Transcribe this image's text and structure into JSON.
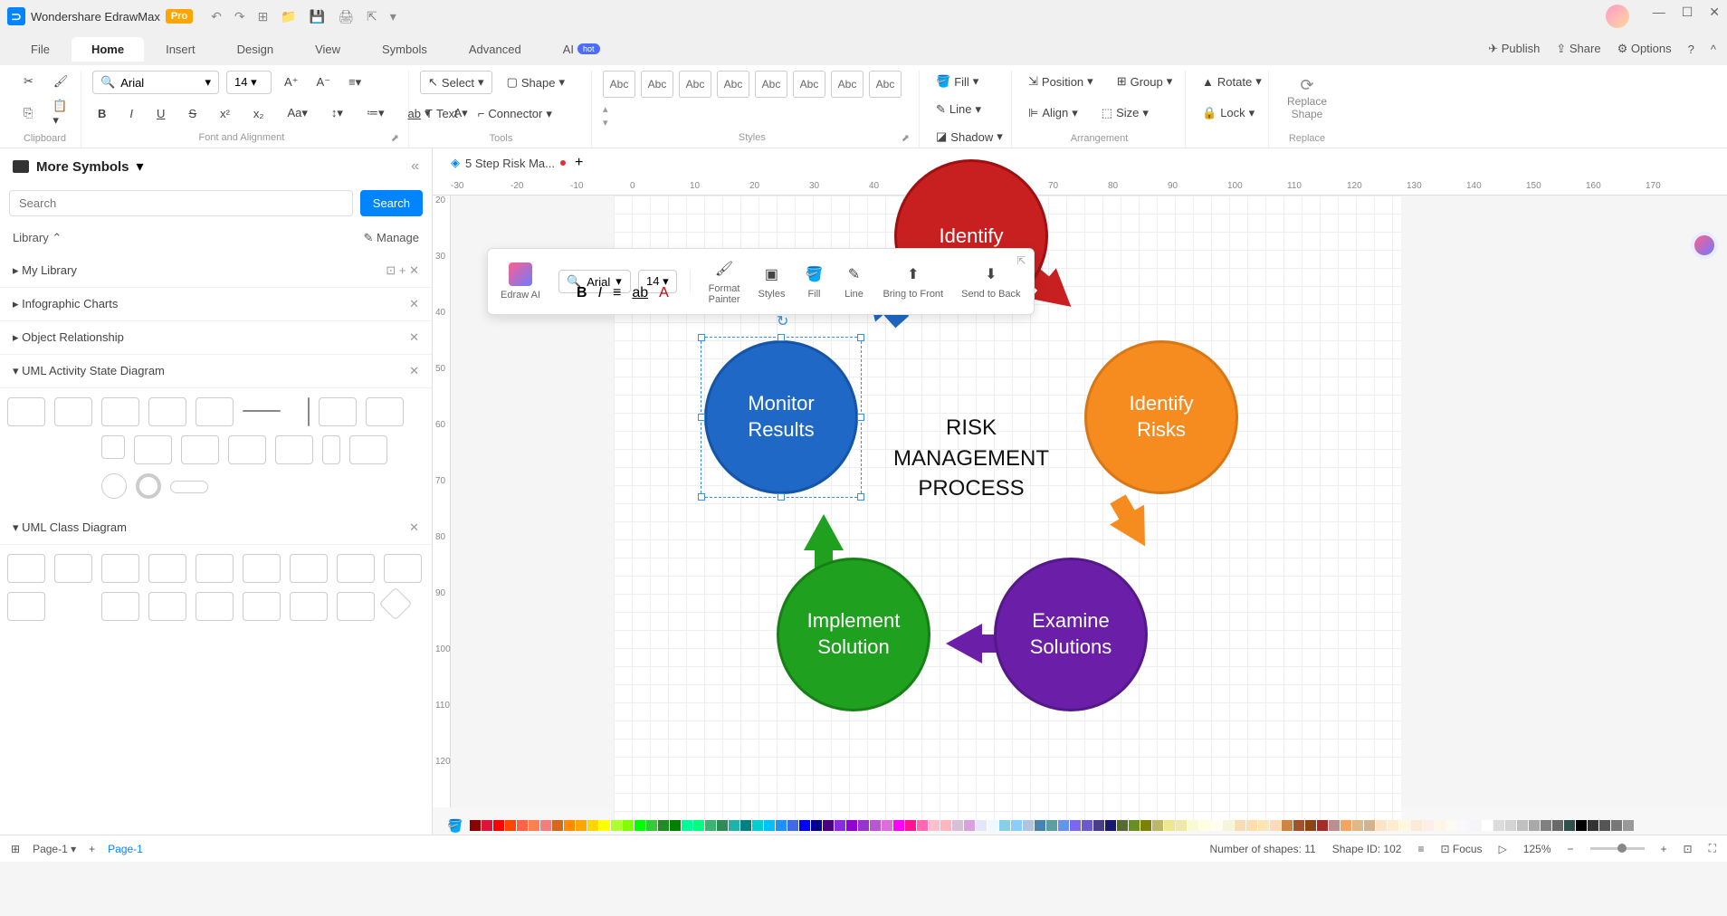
{
  "titlebar": {
    "app_name": "Wondershare EdrawMax",
    "pro": "Pro"
  },
  "menubar": {
    "tabs": [
      "File",
      "Home",
      "Insert",
      "Design",
      "View",
      "Symbols",
      "Advanced",
      "AI"
    ],
    "active": "Home",
    "hot": "hot",
    "right": {
      "publish": "Publish",
      "share": "Share",
      "options": "Options"
    }
  },
  "ribbon": {
    "clipboard": "Clipboard",
    "font_align": "Font and Alignment",
    "tools": "Tools",
    "styles": "Styles",
    "arrangement": "Arrangement",
    "replace": "Replace",
    "font": "Arial",
    "size": "14",
    "select": "Select",
    "shape": "Shape",
    "text": "Text",
    "connector": "Connector",
    "style_label": "Abc",
    "fill": "Fill",
    "line": "Line",
    "shadow": "Shadow",
    "position": "Position",
    "align": "Align",
    "group": "Group",
    "size_btn": "Size",
    "rotate": "Rotate",
    "lock": "Lock",
    "replace_shape": "Replace\nShape"
  },
  "sidebar": {
    "title": "More Symbols",
    "search_ph": "Search",
    "search_btn": "Search",
    "library": "Library",
    "manage": "Manage",
    "mylibrary": "My Library",
    "cats": [
      "Infographic Charts",
      "Object Relationship",
      "UML Activity State Diagram",
      "UML Class Diagram"
    ]
  },
  "tabs": {
    "file": "5 Step Risk Ma..."
  },
  "ruler_h": [
    "-30",
    "-20",
    "-10",
    "0",
    "10",
    "20",
    "30",
    "40",
    "50",
    "60",
    "70",
    "80",
    "90",
    "100",
    "110",
    "120",
    "130",
    "140",
    "150",
    "160",
    "170"
  ],
  "ruler_v": [
    "20",
    "30",
    "40",
    "50",
    "60",
    "70",
    "80",
    "90",
    "100",
    "110",
    "120"
  ],
  "diagram": {
    "center": "RISK\nMANAGEMENT\nPROCESS",
    "nodes": {
      "monitor": "Monitor\nResults",
      "identify": "Identify\nRisks",
      "examine": "Examine\nSolutions",
      "implement": "Implement\nSolution",
      "top": "Identify"
    }
  },
  "float": {
    "edraw_ai": "Edraw AI",
    "font": "Arial",
    "size": "14",
    "format_painter": "Format\nPainter",
    "styles": "Styles",
    "fill": "Fill",
    "line": "Line",
    "bring_front": "Bring to Front",
    "send_back": "Send to Back"
  },
  "colorbar": [
    "#8b0000",
    "#dc143c",
    "#ff0000",
    "#ff4500",
    "#ff6347",
    "#ff7f50",
    "#f08080",
    "#d2691e",
    "#ff8c00",
    "#ffa500",
    "#ffd700",
    "#ffff00",
    "#adff2f",
    "#7fff00",
    "#00ff00",
    "#32cd32",
    "#228b22",
    "#008000",
    "#00fa9a",
    "#00ff7f",
    "#3cb371",
    "#2e8b57",
    "#20b2aa",
    "#008080",
    "#00ced1",
    "#00bfff",
    "#1e90ff",
    "#4169e1",
    "#0000ff",
    "#00008b",
    "#4b0082",
    "#8a2be2",
    "#9400d3",
    "#9932cc",
    "#ba55d3",
    "#da70d6",
    "#ff00ff",
    "#ff1493",
    "#ff69b4",
    "#ffc0cb",
    "#ffb6c1",
    "#d8bfd8",
    "#dda0dd",
    "#e6e6fa",
    "#f0f8ff",
    "#87ceeb",
    "#87cefa",
    "#b0c4de",
    "#4682b4",
    "#5f9ea0",
    "#6495ed",
    "#7b68ee",
    "#6a5acd",
    "#483d8b",
    "#191970",
    "#556b2f",
    "#6b8e23",
    "#808000",
    "#bdb76b",
    "#f0e68c",
    "#eee8aa",
    "#fafad2",
    "#ffffe0",
    "#fffff0",
    "#f5f5dc",
    "#f5deb3",
    "#ffdead",
    "#ffe4b5",
    "#ffdab9",
    "#cd853f",
    "#a0522d",
    "#8b4513",
    "#a52a2a",
    "#bc8f8f",
    "#f4a460",
    "#deb887",
    "#d2b48c",
    "#ffe4c4",
    "#ffebcd",
    "#fff8dc",
    "#faebd7",
    "#faf0e6",
    "#fdf5e6",
    "#fffaf0",
    "#f8f8ff",
    "#f5f5f5",
    "#ffffff",
    "#dcdcdc",
    "#d3d3d3",
    "#c0c0c0",
    "#a9a9a9",
    "#808080",
    "#696969",
    "#2f4f4f",
    "#000000",
    "#333333",
    "#555555",
    "#777777",
    "#999999"
  ],
  "status": {
    "page_sel": "Page-1",
    "page_link": "Page-1",
    "shapes": "Number of shapes: 11",
    "shape_id": "Shape ID: 102",
    "focus": "Focus",
    "zoom": "125%"
  }
}
